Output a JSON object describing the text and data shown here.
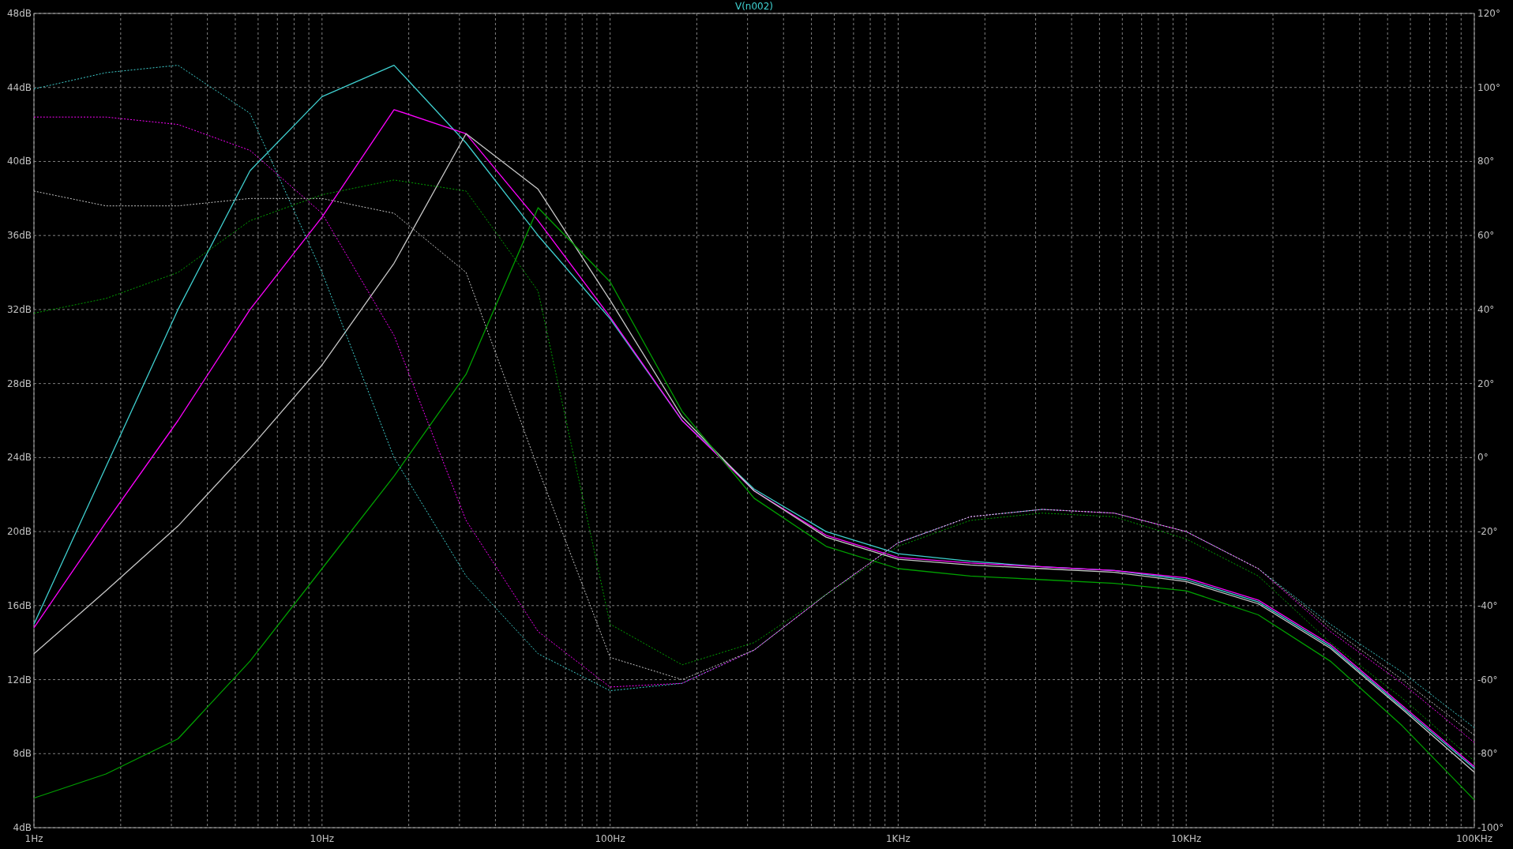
{
  "magnitude_plot": {
    "chart_data": {
      "type": "line",
      "title": "V(n002)",
      "categories": [
        "1Hz",
        null,
        null,
        null,
        "10Hz",
        null,
        null,
        null,
        "100Hz",
        null,
        null,
        null,
        "1KHz",
        null,
        null,
        null,
        "10KHz",
        null,
        null,
        null,
        "100KHz"
      ],
      "ylim": [
        4,
        48
      ],
      "yticks": [
        {
          "value": 4,
          "label": "4dB"
        },
        {
          "value": 8,
          "label": "8dB"
        },
        {
          "value": 12,
          "label": "12dB"
        },
        {
          "value": 16,
          "label": "16dB"
        },
        {
          "value": 20,
          "label": "20dB"
        },
        {
          "value": 24,
          "label": "24dB"
        },
        {
          "value": 28,
          "label": "28dB"
        },
        {
          "value": 32,
          "label": "32dB"
        },
        {
          "value": 36,
          "label": "36dB"
        },
        {
          "value": 40,
          "label": "40dB"
        },
        {
          "value": 44,
          "label": "44dB"
        },
        {
          "value": 48,
          "label": "48dB"
        }
      ],
      "series": [
        {
          "color": "#3fd0d0",
          "line_style": "solid",
          "values": [
            15,
            23.5,
            32,
            39.5,
            43.5,
            45.2,
            41,
            36,
            31.5,
            26,
            22.3,
            20,
            18.8,
            18.4,
            18.1,
            17.9,
            17.4,
            16.2,
            13.8,
            10.5,
            7.2
          ]
        },
        {
          "color": "#ff00ff",
          "line_style": "solid",
          "values": [
            14.8,
            20.5,
            26,
            32,
            37,
            42.8,
            41.5,
            36.8,
            31.6,
            26,
            22.2,
            19.8,
            18.6,
            18.3,
            18.1,
            17.9,
            17.5,
            16.3,
            13.9,
            10.6,
            7.3
          ]
        },
        {
          "color": "#c8c8c8",
          "line_style": "solid",
          "values": [
            13.4,
            16.8,
            20.3,
            24.5,
            29,
            34.5,
            41.5,
            38.5,
            32.5,
            26.2,
            22.2,
            19.7,
            18.5,
            18.2,
            18,
            17.8,
            17.3,
            16.1,
            13.7,
            10.4,
            7
          ]
        },
        {
          "color": "#00a000",
          "line_style": "solid",
          "values": [
            5.6,
            6.9,
            8.8,
            13,
            18,
            23,
            28.5,
            37.5,
            33.5,
            26.5,
            21.8,
            19.2,
            18,
            17.6,
            17.4,
            17.2,
            16.8,
            15.5,
            13,
            9.5,
            5.5
          ]
        }
      ]
    }
  },
  "phase_plot": {
    "chart_data": {
      "type": "line",
      "categories": [
        null,
        null,
        null,
        null,
        null,
        null,
        null,
        null,
        null,
        null,
        null,
        null,
        null,
        null,
        null,
        null,
        null,
        null,
        null,
        null,
        null
      ],
      "ylim": [
        -100,
        120
      ],
      "yticks": [
        {
          "value": -100,
          "label": "-100°"
        },
        {
          "value": -80,
          "label": "-80°"
        },
        {
          "value": -60,
          "label": "-60°"
        },
        {
          "value": -40,
          "label": "-40°"
        },
        {
          "value": -20,
          "label": "-20°"
        },
        {
          "value": 0,
          "label": "0°"
        },
        {
          "value": 20,
          "label": "20°"
        },
        {
          "value": 40,
          "label": "40°"
        },
        {
          "value": 60,
          "label": "60°"
        },
        {
          "value": 80,
          "label": "80°"
        },
        {
          "value": 100,
          "label": "100°"
        },
        {
          "value": 120,
          "label": "120°"
        }
      ],
      "series": [
        {
          "color": "#3fd0d0",
          "line_style": "dotted",
          "values": [
            99.6,
            104,
            106,
            93,
            50,
            0,
            -32,
            -53,
            -63,
            -61,
            -52,
            -37,
            -23,
            -16,
            -14,
            -15,
            -20,
            -30,
            -45,
            -58,
            -73
          ]
        },
        {
          "color": "#ff00ff",
          "line_style": "dotted",
          "values": [
            92,
            92,
            90,
            83,
            66,
            33,
            -17,
            -47,
            -62,
            -61,
            -52,
            -37,
            -23,
            -16,
            -14,
            -15,
            -20,
            -30,
            -47,
            -61,
            -77
          ]
        },
        {
          "color": "#c8c8c8",
          "line_style": "dotted",
          "values": [
            72,
            68,
            68,
            70,
            70,
            66,
            50,
            -3,
            -54,
            -60,
            -52,
            -37,
            -23,
            -16,
            -14,
            -15,
            -20,
            -30,
            -46,
            -60,
            -75
          ]
        },
        {
          "color": "#00a000",
          "line_style": "dotted",
          "values": [
            39,
            43,
            50,
            64,
            71,
            75,
            72,
            45,
            -45,
            -56,
            -50,
            -37,
            -24,
            -17,
            -15,
            -16,
            -22,
            -32,
            -50,
            -65,
            -82
          ]
        }
      ]
    }
  }
}
